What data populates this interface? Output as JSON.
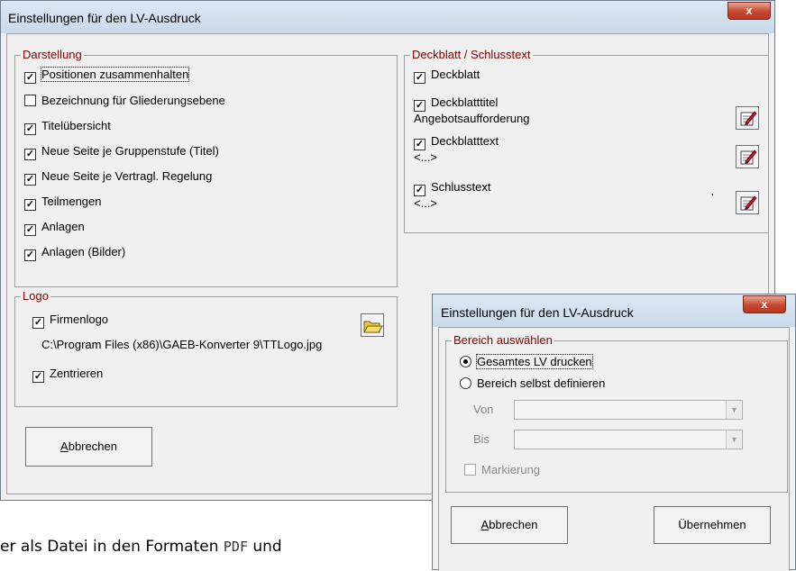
{
  "main_dialog": {
    "title": "Einstellungen für den LV-Ausdruck",
    "close_label": "x",
    "darstellung": {
      "label": "Darstellung",
      "items": [
        {
          "label": "Positionen zusammenhalten",
          "checked": true
        },
        {
          "label": "Bezeichnung für Gliederungsebene",
          "checked": false
        },
        {
          "label": "Titelübersicht",
          "checked": true
        },
        {
          "label": "Neue Seite je Gruppenstufe (Titel)",
          "checked": true
        },
        {
          "label": "Neue Seite je Vertragl. Regelung",
          "checked": true
        },
        {
          "label": "Teilmengen",
          "checked": true
        },
        {
          "label": "Anlagen",
          "checked": true
        },
        {
          "label": "Anlagen (Bilder)",
          "checked": true
        }
      ]
    },
    "deckblatt": {
      "label": "Deckblatt / Schlusstext",
      "items": [
        {
          "label": "Deckblatt",
          "checked": true,
          "sub": ""
        },
        {
          "label": "Deckblatttitel",
          "checked": true,
          "sub": "Angebotsaufforderung"
        },
        {
          "label": "Deckblatttext",
          "checked": true,
          "sub": "<...>"
        },
        {
          "label": "Schlusstext",
          "checked": true,
          "sub": "<...>"
        }
      ]
    },
    "logo": {
      "label": "Logo",
      "firmenlogo_label": "Firmenlogo",
      "path": "C:\\Program Files (x86)\\GAEB-Konverter 9\\TTLogo.jpg",
      "zentrieren_label": "Zentrieren"
    },
    "cancel_first": "A",
    "cancel_rest": "bbrechen"
  },
  "sub_dialog": {
    "title": "Einstellungen für den LV-Ausdruck",
    "close_label": "x",
    "bereich": {
      "label": "Bereich auswählen",
      "option_all": "Gesamtes LV drucken",
      "option_custom": "Bereich selbst definieren",
      "von_label": "Von",
      "bis_label": "Bis",
      "markierung_label": "Markierung"
    },
    "cancel_first": "A",
    "cancel_rest": "bbrechen",
    "apply_label": "Übernehmen"
  },
  "background_text": {
    "part1": "er als Datei in den Formaten ",
    "code": "PDF",
    "part2": " und"
  }
}
